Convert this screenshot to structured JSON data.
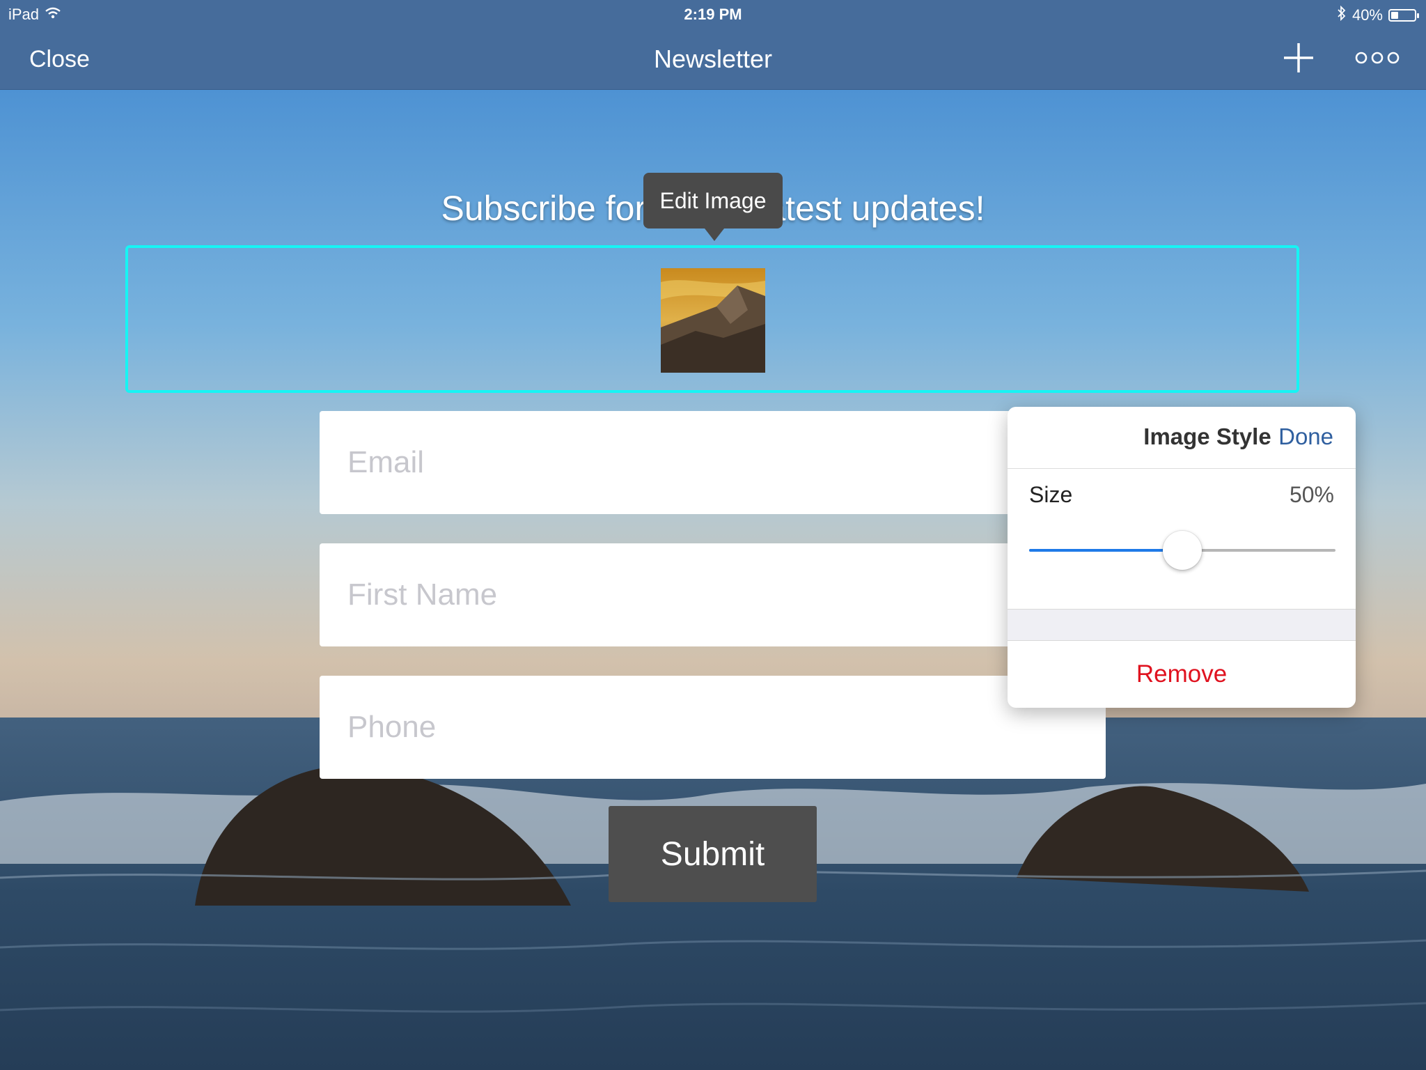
{
  "status_bar": {
    "device": "iPad",
    "time": "2:19 PM",
    "battery_text": "40%",
    "battery_level": 0.4
  },
  "nav": {
    "close_label": "Close",
    "title": "Newsletter",
    "add_icon": "plus-icon",
    "more_icon": "more-icon"
  },
  "form": {
    "headline": "Subscribe for all the latest updates!",
    "tooltip": "Edit Image",
    "email_placeholder": "Email",
    "first_name_placeholder": "First Name",
    "phone_placeholder": "Phone",
    "submit_label": "Submit"
  },
  "popover": {
    "title": "Image Style",
    "done_label": "Done",
    "size_label": "Size",
    "size_value": "50%",
    "slider_level": 0.5,
    "remove_label": "Remove"
  },
  "colors": {
    "nav_bar": "#466c9b",
    "selection_border": "#16f4f4",
    "slider_fill": "#1f7ae8",
    "remove_text": "#e0121f",
    "done_text": "#2f5f9f"
  }
}
